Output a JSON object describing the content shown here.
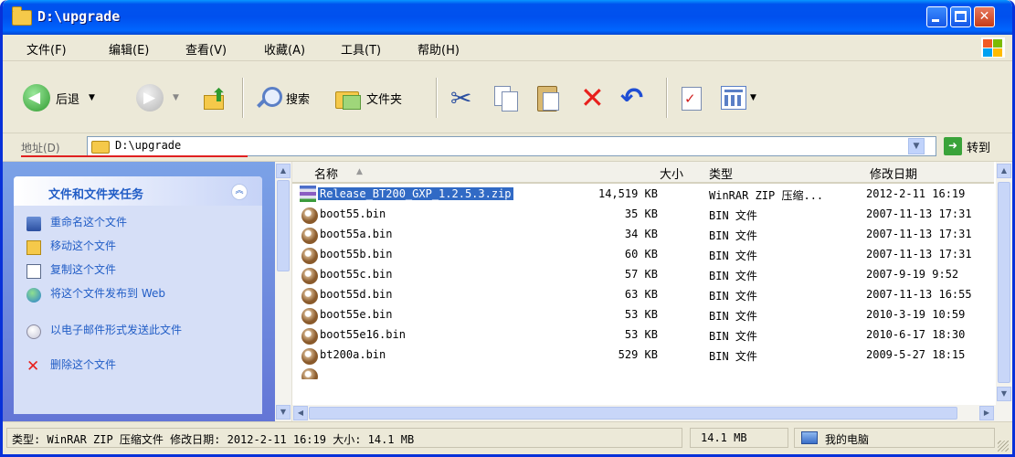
{
  "window": {
    "title": "D:\\upgrade"
  },
  "menu": {
    "items": [
      "文件(F)",
      "编辑(E)",
      "查看(V)",
      "收藏(A)",
      "工具(T)",
      "帮助(H)"
    ]
  },
  "toolbar": {
    "back_label": "后退",
    "search_label": "搜索",
    "folders_label": "文件夹"
  },
  "address": {
    "label": "地址(D)",
    "value": "D:\\upgrade",
    "go_label": "转到"
  },
  "tasks": {
    "title": "文件和文件夹任务",
    "items": [
      "重命名这个文件",
      "移动这个文件",
      "复制这个文件",
      "将这个文件发布到 Web",
      "以电子邮件形式发送此文件",
      "删除这个文件"
    ]
  },
  "columns": {
    "name": "名称",
    "size": "大小",
    "type": "类型",
    "modified": "修改日期"
  },
  "files": [
    {
      "name": "Release_BT200_GXP_1.2.5.3.zip",
      "size": "14,519 KB",
      "type": "WinRAR ZIP 压缩...",
      "modified": "2012-2-11 16:19",
      "icon": "winrar-zip-icon",
      "selected": true
    },
    {
      "name": "boot55.bin",
      "size": "35 KB",
      "type": "BIN 文件",
      "modified": "2007-11-13 17:31",
      "icon": "bin-file-icon"
    },
    {
      "name": "boot55a.bin",
      "size": "34 KB",
      "type": "BIN 文件",
      "modified": "2007-11-13 17:31",
      "icon": "bin-file-icon"
    },
    {
      "name": "boot55b.bin",
      "size": "60 KB",
      "type": "BIN 文件",
      "modified": "2007-11-13 17:31",
      "icon": "bin-file-icon"
    },
    {
      "name": "boot55c.bin",
      "size": "57 KB",
      "type": "BIN 文件",
      "modified": "2007-9-19 9:52",
      "icon": "bin-file-icon"
    },
    {
      "name": "boot55d.bin",
      "size": "63 KB",
      "type": "BIN 文件",
      "modified": "2007-11-13 16:55",
      "icon": "bin-file-icon"
    },
    {
      "name": "boot55e.bin",
      "size": "53 KB",
      "type": "BIN 文件",
      "modified": "2010-3-19 10:59",
      "icon": "bin-file-icon"
    },
    {
      "name": "boot55e16.bin",
      "size": "53 KB",
      "type": "BIN 文件",
      "modified": "2010-6-17 18:30",
      "icon": "bin-file-icon"
    },
    {
      "name": "bt200a.bin",
      "size": "529 KB",
      "type": "BIN 文件",
      "modified": "2009-5-27 18:15",
      "icon": "bin-file-icon"
    }
  ],
  "status": {
    "info": "类型: WinRAR ZIP 压缩文件 修改日期: 2012-2-11 16:19 大小: 14.1 MB",
    "size": "14.1 MB",
    "location": "我的电脑"
  }
}
